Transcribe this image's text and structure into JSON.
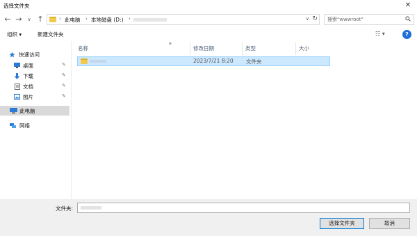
{
  "window": {
    "title": "选择文件夹",
    "close_glyph": "✕"
  },
  "nav": {
    "back": "←",
    "forward": "→",
    "recent": "∨",
    "up": "↑",
    "path": [
      "此电脑",
      "本地磁盘 (D:)"
    ],
    "path_sep": "›",
    "dropdown": "∨",
    "refresh": "↻",
    "search_placeholder": "搜索\"wwwroot\"",
    "search_icon": "magnifier-icon"
  },
  "toolbar": {
    "organize": "组织 ▾",
    "new_folder": "新建文件夹",
    "view": "☷ ▾",
    "help": "?"
  },
  "sidebar": {
    "items": [
      {
        "label": "快速访问",
        "icon": "star-icon",
        "pinned": false
      },
      {
        "label": "桌面",
        "icon": "desktop-icon",
        "pinned": true
      },
      {
        "label": "下载",
        "icon": "download-icon",
        "pinned": true
      },
      {
        "label": "文档",
        "icon": "document-icon",
        "pinned": true
      },
      {
        "label": "图片",
        "icon": "picture-icon",
        "pinned": true
      },
      {
        "label": "此电脑",
        "icon": "computer-icon",
        "pinned": false,
        "selected": true
      },
      {
        "label": "网络",
        "icon": "network-icon",
        "pinned": false
      }
    ],
    "pin_glyph": "📌"
  },
  "columns": {
    "name": "名称",
    "date": "修改日期",
    "type": "类型",
    "size": "大小"
  },
  "rows": [
    {
      "date": "2023/7/21 8:20",
      "type": "文件夹",
      "selected": true
    }
  ],
  "footer": {
    "folder_label": "文件夹:",
    "select_button": "选择文件夹",
    "cancel_button": "取消"
  },
  "colors": {
    "selection": "#cce8ff",
    "selection_border": "#99d1ff",
    "folder": "#f2c94c",
    "accent": "#0078d7"
  }
}
